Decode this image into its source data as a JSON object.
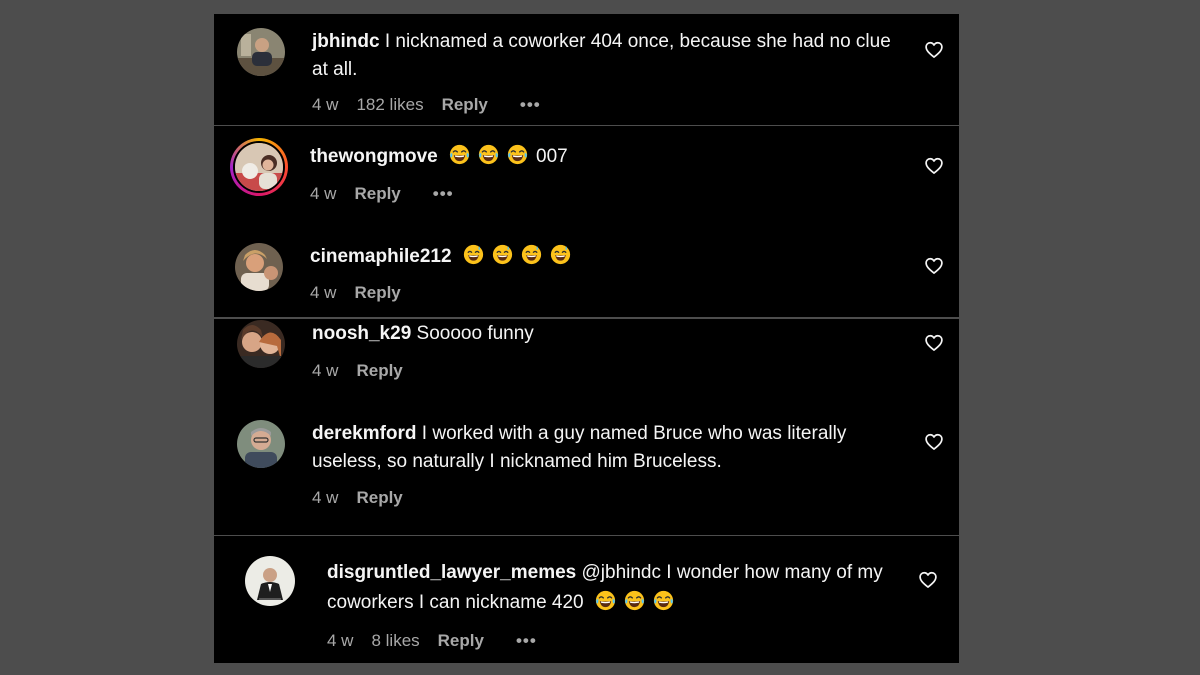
{
  "comments": [
    {
      "username": "jbhindc",
      "text": " I nicknamed a coworker 404 once, because she had no clue at all.",
      "time": "4 w",
      "likes": "182 likes",
      "reply": "Reply",
      "more": "•••"
    },
    {
      "username": "thewongmove",
      "text": "007",
      "time": "4 w",
      "reply": "Reply",
      "more": "•••"
    },
    {
      "username": "cinemaphile212",
      "time": "4 w",
      "reply": "Reply"
    },
    {
      "username": "noosh_k29",
      "text": " Sooooo funny",
      "time": "4 w",
      "reply": "Reply"
    },
    {
      "username": "derekmford",
      "text": " I worked with a guy named Bruce who was literally useless, so naturally I nicknamed him Bruceless.",
      "time": "4 w",
      "reply": "Reply"
    },
    {
      "username": "disgruntled_lawyer_memes",
      "text": " @jbhindc I wonder how many of my coworkers I can nickname 420",
      "time": "4 w",
      "likes": "8 likes",
      "reply": "Reply",
      "more": "•••"
    }
  ],
  "icons": {
    "like": "heart-outline-icon",
    "laugh_emoji": "tears-of-joy-emoji",
    "sweat_emoji": "grinning-sweat-emoji"
  },
  "colors": {
    "background": "#000000",
    "page": "#4d4d4d",
    "text": "#f5f5f5",
    "meta": "#a8a8a8"
  }
}
